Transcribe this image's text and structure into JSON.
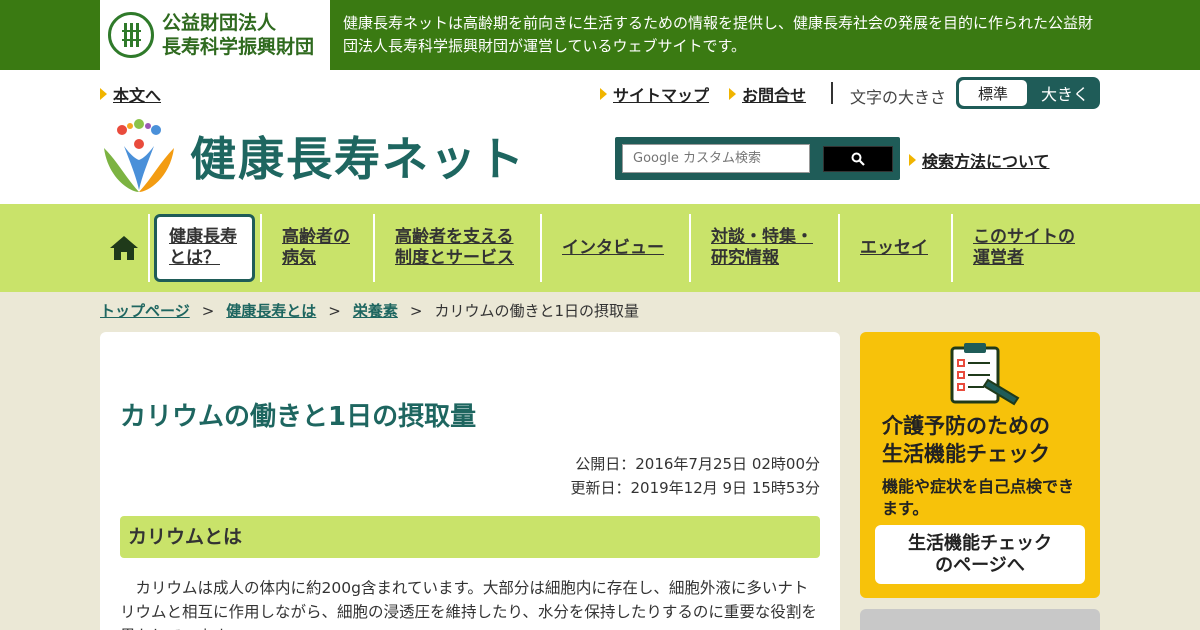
{
  "org": {
    "name_line1": "公益財団法人",
    "name_line2": "長寿科学振興財団",
    "description": "健康長寿ネットは高齢期を前向きに生活するための情報を提供し、健康長寿社会の発展を目的に作られた公益財団法人長寿科学振興財団が運営しているウェブサイトです。"
  },
  "header": {
    "skip_link": "本文へ",
    "sitemap": "サイトマップ",
    "contact": "お問合せ",
    "font_size_label": "文字の大きさ",
    "font_size_standard": "標準",
    "font_size_large": "大きく",
    "site_title": "健康長寿ネット",
    "search_placeholder": "Google カスタム検索",
    "search_help": "検索方法について"
  },
  "nav": {
    "items": [
      {
        "line1": "健康長寿",
        "line2": "とは？"
      },
      {
        "line1": "高齢者の",
        "line2": "病気"
      },
      {
        "line1": "高齢者を支える",
        "line2": "制度とサービス"
      },
      {
        "line1": "インタビュー",
        "line2": ""
      },
      {
        "line1": "対談・特集・",
        "line2": "研究情報"
      },
      {
        "line1": "エッセイ",
        "line2": ""
      },
      {
        "line1": "このサイトの",
        "line2": "運営者"
      }
    ]
  },
  "breadcrumb": {
    "items": [
      "トップページ",
      "健康長寿とは",
      "栄養素"
    ],
    "separator": ">",
    "current": "カリウムの働きと1日の摂取量"
  },
  "main": {
    "title": "カリウムの働きと1日の摂取量",
    "published": "公開日：2016年7月25日 02時00分",
    "updated": "更新日：2019年12月 9日 15時53分",
    "section_title": "カリウムとは",
    "body": "カリウムは成人の体内に約200g含まれています。大部分は細胞内に存在し、細胞外液に多いナトリウムと相互に作用しながら、細胞の浸透圧を維持したり、水分を保持したりするのに重要な役割を果たしています。"
  },
  "sidebar": {
    "title_line1": "介護予防のための",
    "title_line2": "生活機能チェック",
    "description": "機能や症状を自己点検できます。",
    "button_line1": "生活機能チェック",
    "button_line2": "のページへ"
  },
  "colors": {
    "brand_green": "#3a7a12",
    "teal": "#1f5c58",
    "lime": "#c9e36a",
    "yellow": "#f7c20a"
  }
}
